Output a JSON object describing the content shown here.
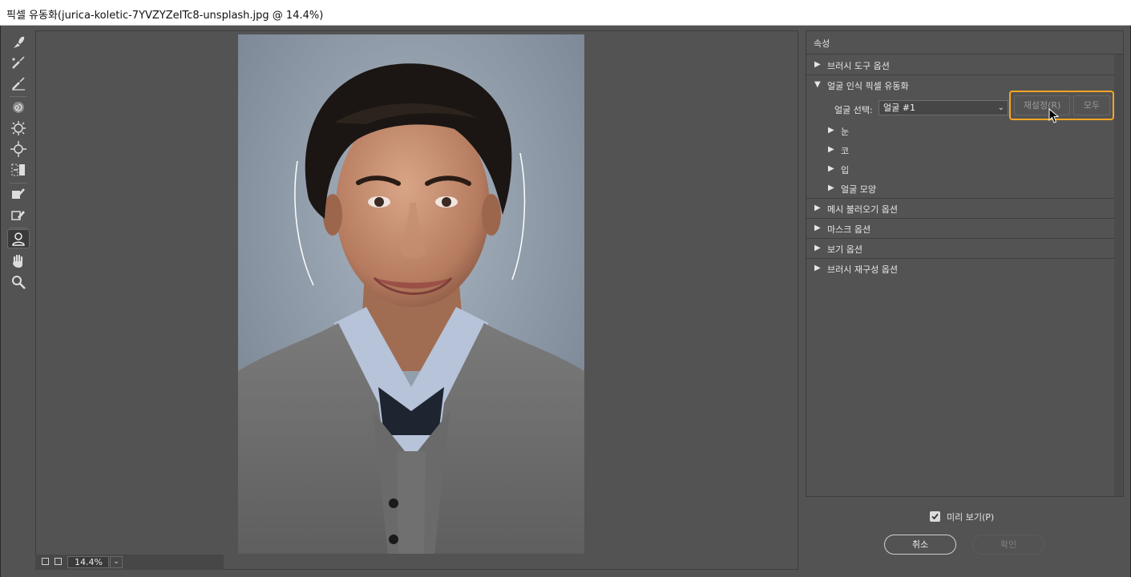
{
  "window": {
    "title": "픽셀 유동화(jurica-koletic-7YVZYZeITc8-unsplash.jpg @ 14.4%)"
  },
  "toolbar": {
    "tools": [
      {
        "name": "forward-warp-tool",
        "icon": "forward-warp-icon"
      },
      {
        "name": "reconstruct-tool",
        "icon": "reconstruct-icon"
      },
      {
        "name": "smooth-tool",
        "icon": "smooth-icon"
      },
      {
        "name": "twirl-clockwise-tool",
        "icon": "twirl-icon"
      },
      {
        "name": "pucker-tool",
        "icon": "pucker-icon"
      },
      {
        "name": "bloat-tool",
        "icon": "bloat-icon"
      },
      {
        "name": "push-left-tool",
        "icon": "push-left-icon"
      },
      {
        "name": "freeze-mask-tool",
        "icon": "freeze-mask-icon"
      },
      {
        "name": "thaw-mask-tool",
        "icon": "thaw-mask-icon"
      },
      {
        "name": "face-tool",
        "icon": "face-icon",
        "active": true
      },
      {
        "name": "hand-tool",
        "icon": "hand-icon"
      },
      {
        "name": "zoom-tool",
        "icon": "zoom-icon"
      }
    ]
  },
  "status": {
    "zoom_value": "14.4%"
  },
  "panel": {
    "header": "속성",
    "sections": {
      "brush_tool": "브러시 도구 옵션",
      "face_aware": "얼굴 인식 픽셀 유동화",
      "mesh_load": "메시 불러오기 옵션",
      "mask": "마스크 옵션",
      "view": "보기 옵션",
      "brush_reconstruct": "브러시 재구성 옵션"
    },
    "face_select_label": "얼굴 선택:",
    "face_select_value": "얼굴 #1",
    "reset_label": "재설정(R)",
    "all_label": "모두",
    "subsections": {
      "eyes": "눈",
      "nose": "코",
      "mouth": "입",
      "face_shape": "얼굴 모양"
    }
  },
  "footer": {
    "preview_label": "미리 보기(P)",
    "preview_checked": true,
    "cancel_label": "취소",
    "ok_label": "확인"
  },
  "colors": {
    "highlight": "#f5a623",
    "background": "#535353"
  }
}
